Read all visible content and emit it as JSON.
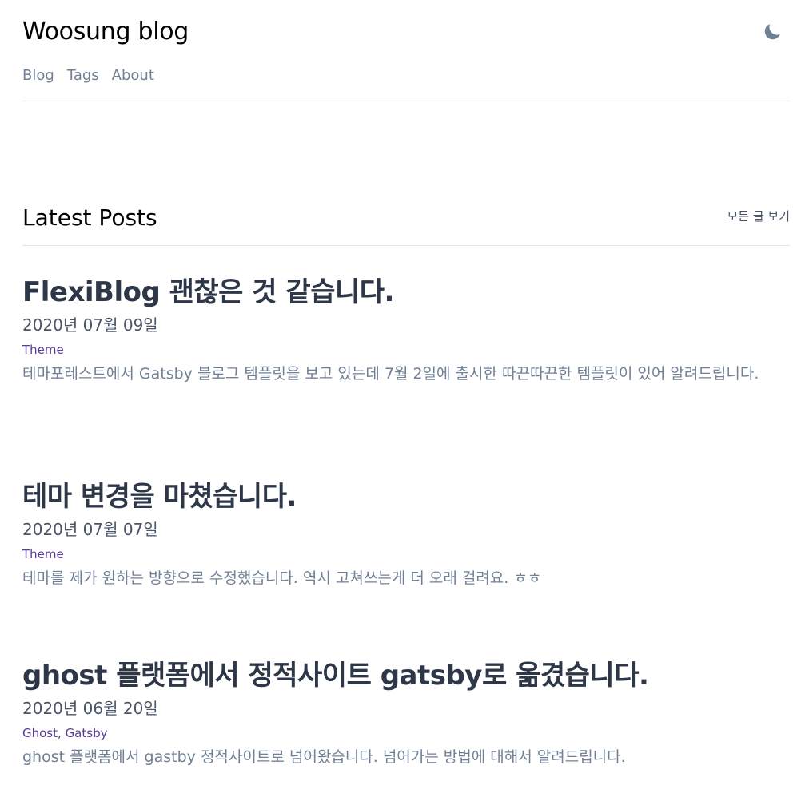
{
  "site": {
    "title": "Woosung blog"
  },
  "nav": {
    "items": [
      {
        "label": "Blog"
      },
      {
        "label": "Tags"
      },
      {
        "label": "About"
      }
    ]
  },
  "theme_toggle": {
    "icon": "moon-icon",
    "color": "#718096"
  },
  "latest": {
    "heading": "Latest Posts",
    "all_link": "모든 글 보기"
  },
  "posts": [
    {
      "title": "FlexiBlog 괜찮은 것 같습니다.",
      "date": "2020년 07월 09일",
      "tags": [
        "Theme"
      ],
      "excerpt": "테마포레스트에서 Gatsby 블로그 템플릿을 보고 있는데 7월 2일에 출시한 따끈따끈한 템플릿이 있어 알려드립니다."
    },
    {
      "title": "테마 변경을 마쳤습니다.",
      "date": "2020년 07월 07일",
      "tags": [
        "Theme"
      ],
      "excerpt": "테마를 제가 원하는 방향으로 수정했습니다. 역시 고쳐쓰는게 더 오래 걸려요. ㅎㅎ"
    },
    {
      "title": "ghost 플랫폼에서 정적사이트 gatsby로 옮겼습니다.",
      "date": "2020년 06월 20일",
      "tags": [
        "Ghost",
        "Gatsby"
      ],
      "excerpt": "ghost 플랫폼에서 gastby 정적사이트로 넘어왔습니다. 넘어가는 방법에 대해서 알려드립니다."
    }
  ],
  "colors": {
    "accent": "#553c9a",
    "title": "#2d3748",
    "muted": "#718096",
    "divider": "#e2e8f0"
  }
}
